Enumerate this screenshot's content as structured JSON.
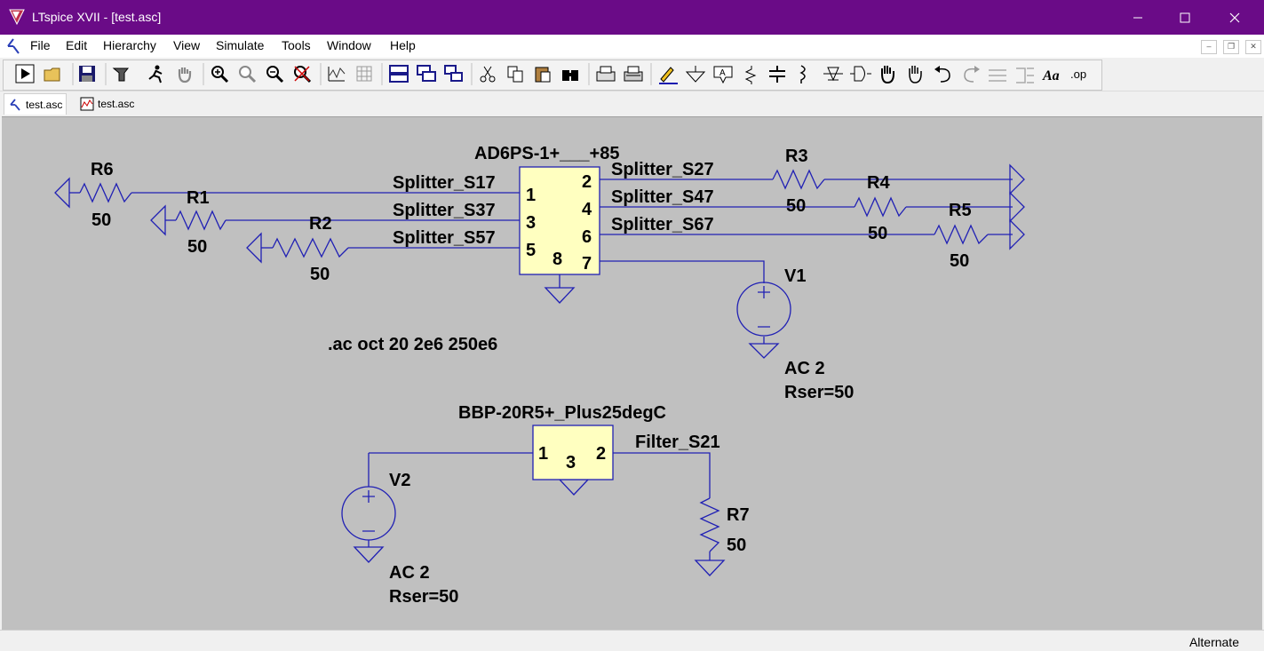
{
  "window": {
    "title": "LTspice XVII - [test.asc]",
    "controls": {
      "minimize": "minimize",
      "maximize": "maximize",
      "close": "close"
    }
  },
  "menu": {
    "items": [
      {
        "label": "File"
      },
      {
        "label": "Edit"
      },
      {
        "label": "Hierarchy"
      },
      {
        "label": "View"
      },
      {
        "label": "Simulate"
      },
      {
        "label": "Tools"
      },
      {
        "label": "Window"
      },
      {
        "label": "Help"
      }
    ]
  },
  "toolbar": {
    "icons": [
      "run-icon",
      "open-icon",
      "save-icon",
      "control-panel-icon",
      "run-man-icon",
      "pan-hand-icon",
      "zoom-in-icon",
      "zoom-full-icon",
      "zoom-out-icon",
      "zoom-cancel-icon",
      "autorange-icon",
      "grid-icon",
      "tile-horizontal-icon",
      "tile-vertical-icon",
      "cascade-icon",
      "cut-icon",
      "copy-icon",
      "paste-icon",
      "find-icon",
      "print-icon",
      "print-setup-icon",
      "draw-wire-icon",
      "ground-icon",
      "label-net-icon",
      "resistor-icon",
      "capacitor-icon",
      "inductor-icon",
      "diode-icon",
      "component-icon",
      "move-icon",
      "drag-icon",
      "undo-icon",
      "redo-icon",
      "rotate-icon",
      "mirror-icon",
      "text-icon",
      "spice-directive-icon"
    ],
    "text_icon_label": "Aa",
    "op_icon_label": ".op"
  },
  "tabs": [
    {
      "label": "test.asc",
      "kind": "schematic",
      "active": true
    },
    {
      "label": "test.asc",
      "kind": "waveform",
      "active": false
    }
  ],
  "schematic": {
    "colors": {
      "wire": "#2020b4",
      "component_fill": "#ffffc0",
      "background": "#c0c0c0"
    },
    "splitter": {
      "name": "AD6PS-1+___+85",
      "pins": [
        "1",
        "3",
        "5",
        "2",
        "4",
        "6",
        "8",
        "7"
      ],
      "nets_left": [
        "Splitter_S17",
        "Splitter_S37",
        "Splitter_S57"
      ],
      "nets_right": [
        "Splitter_S27",
        "Splitter_S47",
        "Splitter_S67"
      ]
    },
    "filter": {
      "name": "BBP-20R5+_Plus25degC",
      "pins": [
        "1",
        "3",
        "2"
      ],
      "net_out": "Filter_S21"
    },
    "resistors": [
      {
        "name": "R6",
        "value": "50"
      },
      {
        "name": "R1",
        "value": "50"
      },
      {
        "name": "R2",
        "value": "50"
      },
      {
        "name": "R3",
        "value": "50"
      },
      {
        "name": "R4",
        "value": "50"
      },
      {
        "name": "R5",
        "value": "50"
      },
      {
        "name": "R7",
        "value": "50"
      }
    ],
    "sources": [
      {
        "name": "V1",
        "value": "AC 2",
        "rser": "Rser=50"
      },
      {
        "name": "V2",
        "value": "AC 2",
        "rser": "Rser=50"
      }
    ],
    "directive": ".ac oct 20 2e6 250e6"
  },
  "status": {
    "mode": "Alternate"
  }
}
